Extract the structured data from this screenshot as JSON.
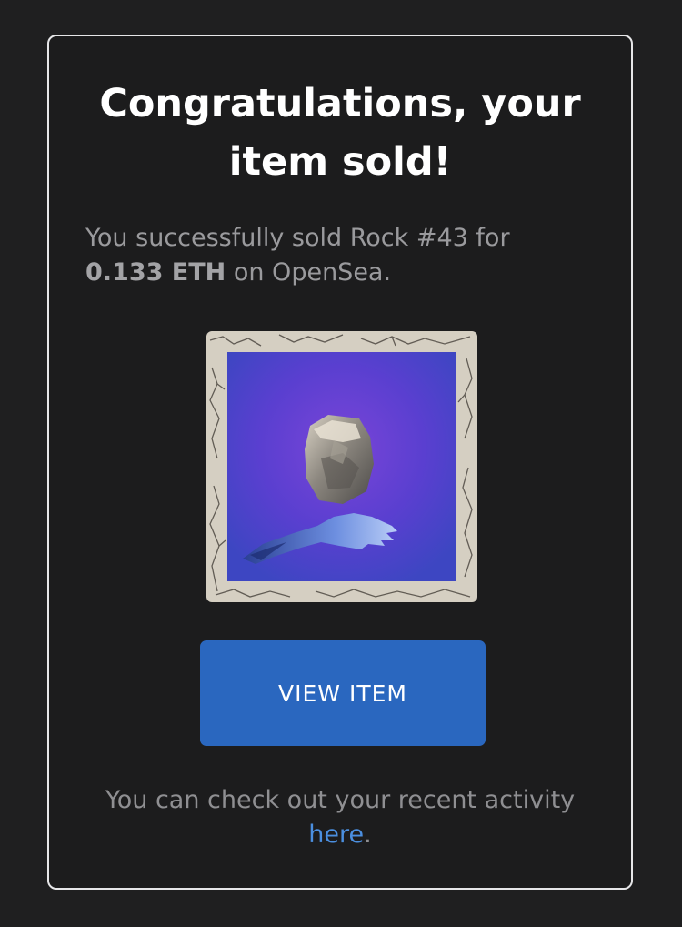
{
  "email": {
    "headline_line1": "Congratulations, your",
    "headline_line2": "item sold!",
    "message_prefix": "You successfully sold Rock #43 for",
    "price": "0.133 ETH",
    "message_suffix": " on OpenSea.",
    "view_button_label": "VIEW ITEM",
    "footer_prefix": "You can check out your recent activity",
    "footer_link": "here",
    "footer_suffix": "."
  },
  "colors": {
    "background": "#1f1f20",
    "card_border": "#e6e6e8",
    "button": "#2a67bf",
    "link": "#4b8fe0",
    "artwork_background": "#5a3fd0"
  },
  "icons": {
    "artwork": "rock-nft-image"
  }
}
